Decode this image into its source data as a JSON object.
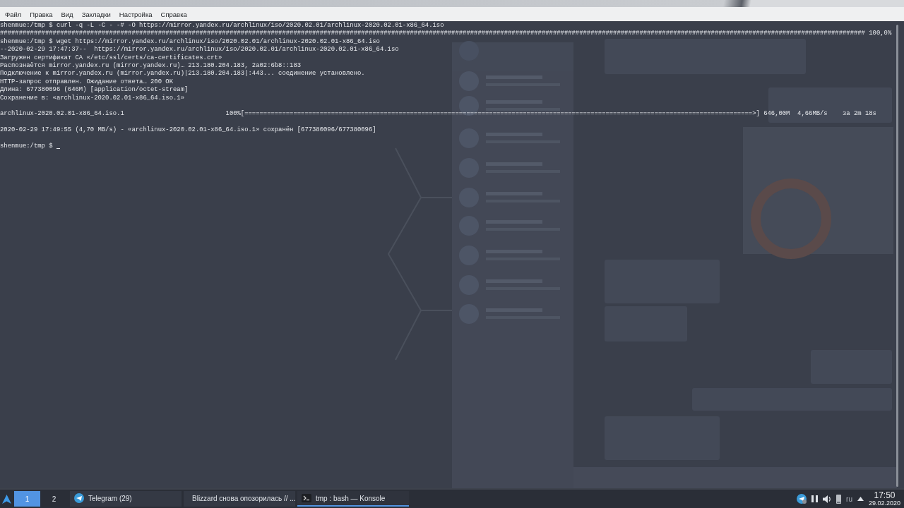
{
  "menu_bar": [
    "Файл",
    "Правка",
    "Вид",
    "Закладки",
    "Настройка",
    "Справка"
  ],
  "terminal": {
    "lines": [
      {
        "kind": "text",
        "text": "shenmue:/tmp $ curl -q -L -C - -# -O https://mirror.yandex.ru/archlinux/iso/2020.02.01/archlinux-2020.02.01-x86_64.iso"
      },
      {
        "kind": "text",
        "text": "###################################################################################################################################################################################################################################### 100,0%"
      },
      {
        "kind": "text",
        "text": "shenmue:/tmp $ wget https://mirror.yandex.ru/archlinux/iso/2020.02.01/archlinux-2020.02.01-x86_64.iso"
      },
      {
        "kind": "text",
        "text": "--2020-02-29 17:47:37--  https://mirror.yandex.ru/archlinux/iso/2020.02.01/archlinux-2020.02.01-x86_64.iso"
      },
      {
        "kind": "text",
        "text": "Загружен сертификат CA «/etc/ssl/certs/ca-certificates.crt»"
      },
      {
        "kind": "text",
        "text": "Распознаётся mirror.yandex.ru (mirror.yandex.ru)… 213.180.204.183, 2a02:6b8::183"
      },
      {
        "kind": "text",
        "text": "Подключение к mirror.yandex.ru (mirror.yandex.ru)|213.180.204.183|:443... соединение установлено."
      },
      {
        "kind": "text",
        "text": "HTTP-запрос отправлен. Ожидание ответа… 200 OK"
      },
      {
        "kind": "text",
        "text": "Длина: 677380096 (646M) [application/octet-stream]"
      },
      {
        "kind": "text",
        "text": "Сохранение в: «archlinux-2020.02.01-x86_64.iso.1»"
      },
      {
        "kind": "blank"
      },
      {
        "kind": "text",
        "text": "archlinux-2020.02.01-x86_64.iso.1                           100%[=======================================================================================================================================>] 646,00M  4,66MB/s    за 2m 18s"
      },
      {
        "kind": "blank"
      },
      {
        "kind": "text",
        "text": "2020-02-29 17:49:55 (4,70 MB/s) - «archlinux-2020.02.01-x86_64.iso.1» сохранён [677380096/677380096]"
      },
      {
        "kind": "blank"
      },
      {
        "kind": "prompt",
        "text": "shenmue:/tmp $ "
      }
    ]
  },
  "taskbar": {
    "desktops": [
      {
        "label": "1",
        "selected": true
      },
      {
        "label": "2",
        "selected": false
      }
    ],
    "tasks": [
      {
        "kind": "telegram",
        "label": "Telegram (29)",
        "active": false
      },
      {
        "kind": "browser",
        "label": "Blizzard снова опозорилась // ...",
        "active": false
      },
      {
        "kind": "terminal",
        "label": "tmp : bash — Konsole",
        "active": true
      }
    ],
    "tray": {
      "language": "ru",
      "time": "17:50",
      "date": "29.02.2020"
    }
  }
}
